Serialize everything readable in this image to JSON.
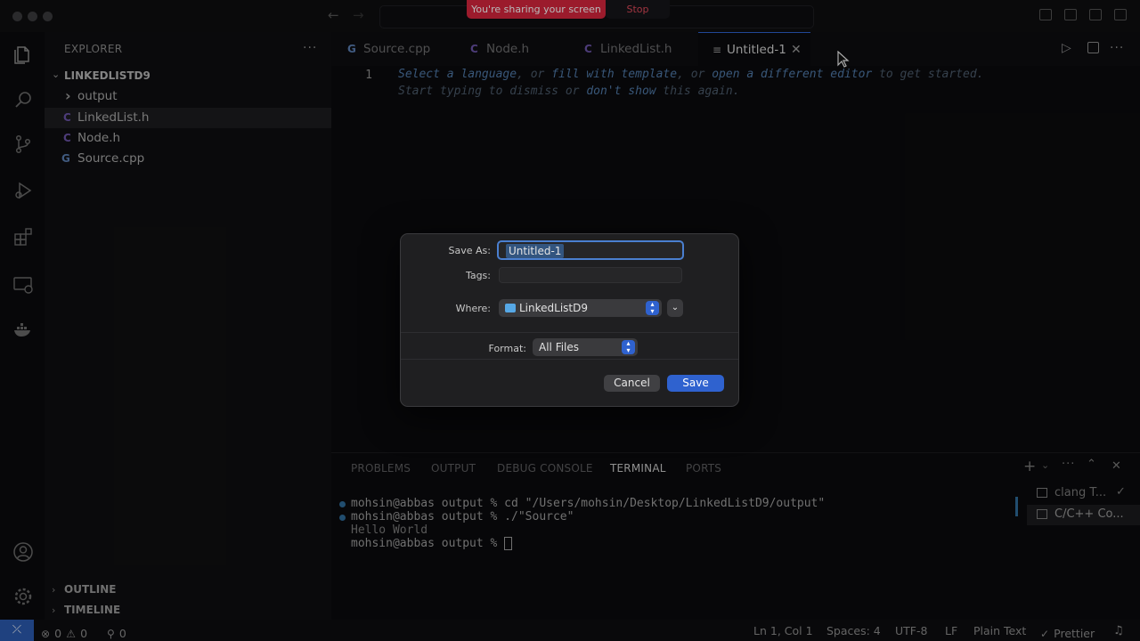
{
  "screen_share": {
    "banner_label": "You're sharing your screen",
    "stop_label": "Stop"
  },
  "sidebar": {
    "title": "EXPLORER",
    "folder": "LINKEDLISTD9",
    "items": [
      {
        "label": "output",
        "icon": "chevron-right-icon",
        "glyph": "›"
      },
      {
        "label": "LinkedList.h",
        "icon": "c-file-icon",
        "glyph": "C"
      },
      {
        "label": "Node.h",
        "icon": "c-file-icon",
        "glyph": "C"
      },
      {
        "label": "Source.cpp",
        "icon": "cpp-file-icon",
        "glyph": "G"
      }
    ],
    "outline_label": "OUTLINE",
    "timeline_label": "TIMELINE"
  },
  "tabs": [
    {
      "label": "Source.cpp",
      "glyph": "G"
    },
    {
      "label": "Node.h",
      "glyph": "C"
    },
    {
      "label": "LinkedList.h",
      "glyph": "C"
    },
    {
      "label": "Untitled-1",
      "glyph": "≡",
      "active": true
    }
  ],
  "editor": {
    "line_number": "1",
    "hint_line1": {
      "a": "Select a language",
      "b": ", or ",
      "c": "fill with template",
      "d": ", or ",
      "e": "open a different editor",
      "f": " to get started."
    },
    "hint_line2": {
      "a": "Start typing to dismiss or ",
      "b": "don't show",
      "c": " this again."
    }
  },
  "dialog": {
    "save_as_label": "Save As:",
    "save_as_value": "Untitled-1",
    "tags_label": "Tags:",
    "where_label": "Where:",
    "where_value": "LinkedListD9",
    "format_label": "Format:",
    "format_value": "All Files",
    "cancel_label": "Cancel",
    "save_label": "Save"
  },
  "panel": {
    "tabs": [
      "PROBLEMS",
      "OUTPUT",
      "DEBUG CONSOLE",
      "TERMINAL",
      "PORTS"
    ],
    "active_tab": "TERMINAL",
    "terminal_lines": [
      "mohsin@abbas output % cd \"/Users/mohsin/Desktop/LinkedListD9/output\"",
      "mohsin@abbas output % ./\"Source\"",
      "Hello World",
      "mohsin@abbas output % "
    ],
    "terminals": [
      "clang T...",
      "C/C++ Co..."
    ]
  },
  "statusbar": {
    "errors": "0",
    "warnings": "0",
    "ports": "0",
    "position": "Ln 1, Col 1",
    "spaces": "Spaces: 4",
    "encoding": "UTF-8",
    "eol": "LF",
    "language": "Plain Text",
    "formatter": "Prettier"
  },
  "colors": {
    "accent": "#2f62cf",
    "share_red": "#d7263d",
    "status_remote": "#2b5ab0"
  }
}
